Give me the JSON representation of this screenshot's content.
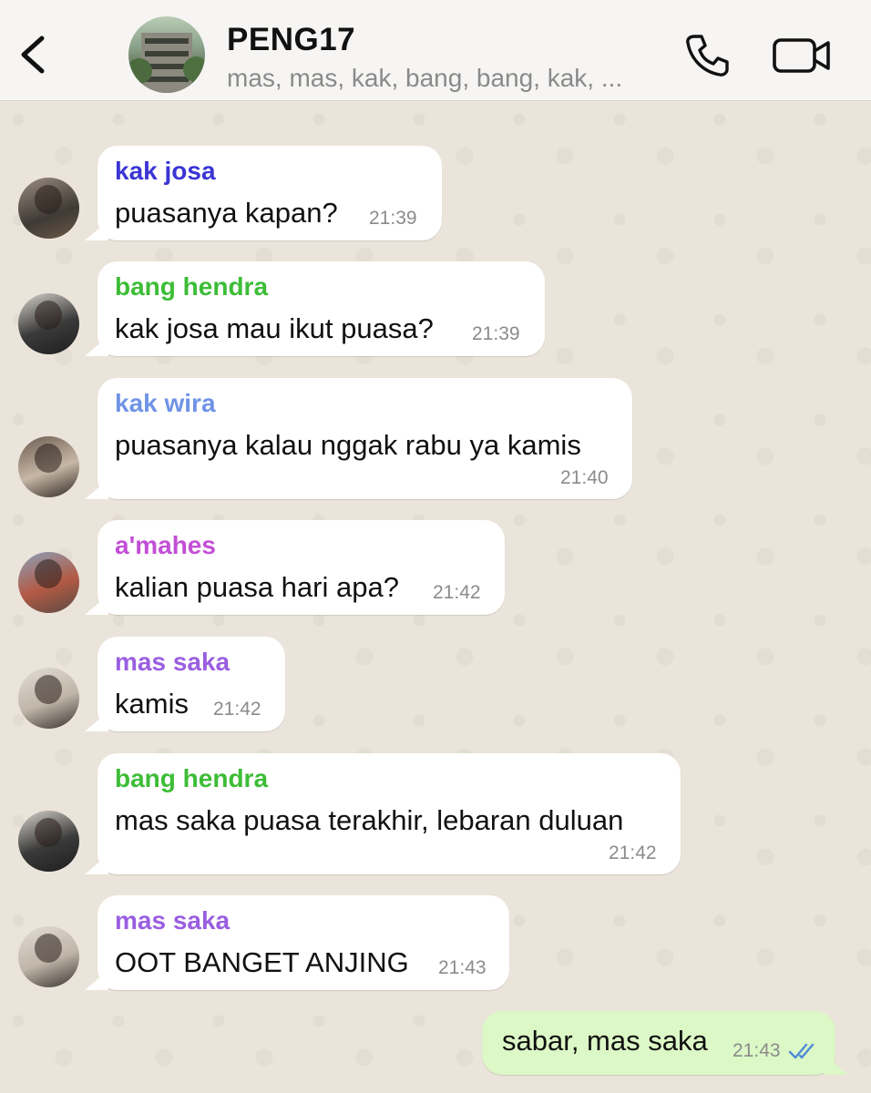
{
  "header": {
    "title": "PENG17",
    "subtitle": "mas, mas, kak, bang, bang, kak, ..."
  },
  "messages": [
    {
      "sender": "kak josa",
      "sender_color": "#3b35d4",
      "text": "puasanya kapan?",
      "time": "21:39"
    },
    {
      "sender": "bang hendra",
      "sender_color": "#3dbd37",
      "text": "kak josa mau ikut puasa?",
      "time": "21:39"
    },
    {
      "sender": "kak wira",
      "sender_color": "#6f93e6",
      "text": "puasanya kalau nggak rabu ya kamis",
      "time": "21:40"
    },
    {
      "sender": "a'mahes",
      "sender_color": "#c24fd6",
      "text": "kalian puasa hari apa?",
      "time": "21:42"
    },
    {
      "sender": "mas saka",
      "sender_color": "#9a5ee0",
      "text": "kamis",
      "time": "21:42"
    },
    {
      "sender": "bang hendra",
      "sender_color": "#3dbd37",
      "text": "mas saka puasa terakhir, lebaran duluan",
      "time": "21:42"
    },
    {
      "sender": "mas saka",
      "sender_color": "#9a5ee0",
      "text": "OOT BANGET ANJING",
      "time": "21:43"
    }
  ],
  "outgoing": {
    "text": "sabar, mas saka",
    "time": "21:43",
    "status": "read"
  },
  "colors": {
    "outgoing_bubble": "#dcf8c6",
    "incoming_bubble": "#ffffff",
    "read_ticks": "#4f8ad8",
    "wallpaper": "#ebe4da"
  }
}
